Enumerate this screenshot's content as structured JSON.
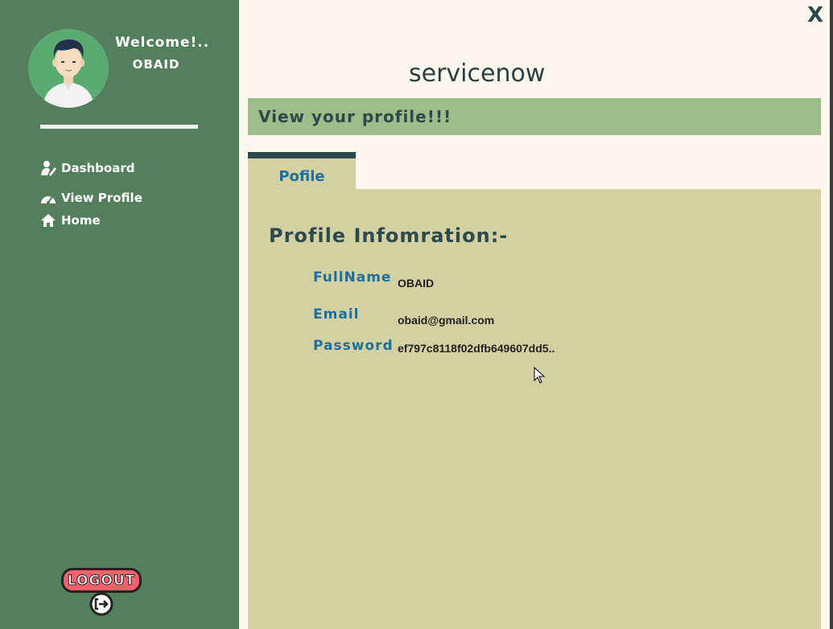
{
  "sidebar": {
    "welcome": "Welcome!..",
    "username": "OBAID",
    "nav": [
      {
        "label": "Dashboard",
        "icon": "user-edit-icon"
      },
      {
        "label": "View Profile",
        "icon": "dashboard-gauge-icon"
      },
      {
        "label": "Home",
        "icon": "home-icon"
      }
    ],
    "logout_label": "LOGOUT"
  },
  "header": {
    "brand": "servicenow",
    "banner": "View your profile!!!"
  },
  "tabs": [
    {
      "label": "Pofile"
    }
  ],
  "profile": {
    "title": "Profile Infomration:-",
    "fields": [
      {
        "label": "FullName",
        "value": "OBAID"
      },
      {
        "label": "Email",
        "value": "obaid@gmail.com"
      },
      {
        "label": "Password",
        "value": "ef797c8118f02dfb649607dd5.."
      }
    ]
  },
  "close_label": "X",
  "colors": {
    "sidebar": "#547f5c",
    "background": "#fef9ee",
    "banner": "#9cbd88",
    "panel": "#d3d0a1",
    "accent_dark": "#2c4a4c",
    "label_blue": "#1f6f9e",
    "logout_red": "#f6616b"
  }
}
